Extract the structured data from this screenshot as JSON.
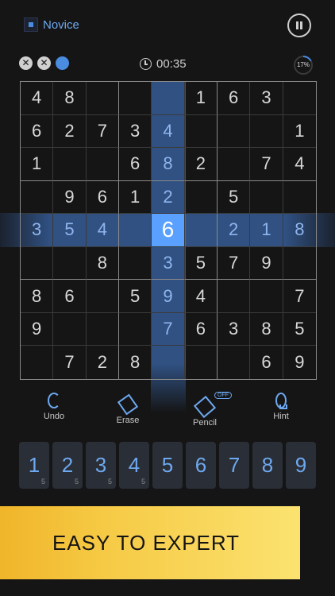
{
  "header": {
    "level_label": "Novice"
  },
  "status": {
    "mistakes": [
      "✕",
      "✕",
      ""
    ],
    "timer": "00:35",
    "progress_label": "17%",
    "progress_value": 0.17
  },
  "board": [
    [
      "4",
      "8",
      "",
      "",
      "",
      "1",
      "6",
      "3",
      ""
    ],
    [
      "6",
      "2",
      "7",
      "3",
      "4",
      "",
      "",
      "",
      "1"
    ],
    [
      "1",
      "",
      "",
      "6",
      "8",
      "2",
      "",
      "7",
      "4"
    ],
    [
      "",
      "9",
      "6",
      "1",
      "2",
      "",
      "5",
      "",
      ""
    ],
    [
      "3",
      "5",
      "4",
      "",
      "6",
      "",
      "2",
      "1",
      "8"
    ],
    [
      "",
      "",
      "8",
      "",
      "3",
      "5",
      "7",
      "9",
      ""
    ],
    [
      "8",
      "6",
      "",
      "5",
      "9",
      "4",
      "",
      "",
      "7"
    ],
    [
      "9",
      "",
      "",
      "",
      "7",
      "6",
      "3",
      "8",
      "5"
    ],
    [
      "",
      "7",
      "2",
      "8",
      "",
      "",
      "",
      "6",
      "9"
    ]
  ],
  "selected": {
    "row": 4,
    "col": 4
  },
  "tools": [
    {
      "label": "Undo"
    },
    {
      "label": "Erase"
    },
    {
      "label": "Pencil",
      "badge": "OFF"
    },
    {
      "label": "Hint"
    }
  ],
  "numpad": [
    {
      "num": "1",
      "count": "5"
    },
    {
      "num": "2",
      "count": "5"
    },
    {
      "num": "3",
      "count": "5"
    },
    {
      "num": "4",
      "count": "5"
    },
    {
      "num": "5",
      "count": ""
    },
    {
      "num": "6",
      "count": ""
    },
    {
      "num": "7",
      "count": ""
    },
    {
      "num": "8",
      "count": ""
    },
    {
      "num": "9",
      "count": ""
    }
  ],
  "banner": {
    "text": "EASY TO EXPERT"
  },
  "colors": {
    "accent": "#4a8ce0",
    "selected_cell": "#5aa0ff",
    "banner": "#f6ca45"
  }
}
